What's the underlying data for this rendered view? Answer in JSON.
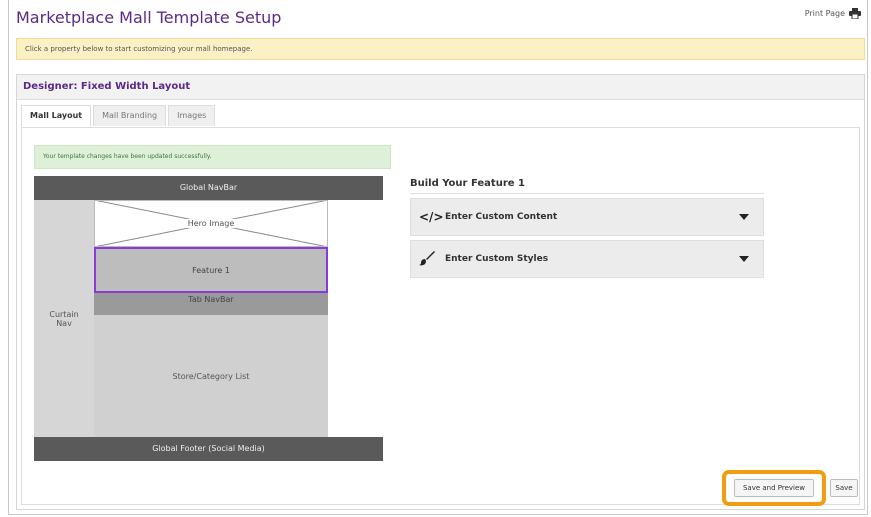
{
  "page": {
    "title": "Marketplace Mall Template Setup",
    "print_label": "Print Page",
    "notice": "Click a property below to start customizing your mall homepage."
  },
  "designer": {
    "heading": "Designer: Fixed Width Layout",
    "tabs": [
      {
        "label": "Mall Layout",
        "active": true
      },
      {
        "label": "Mall Branding",
        "active": false
      },
      {
        "label": "Images",
        "active": false
      }
    ],
    "success": "Your template changes have been updated successfully."
  },
  "layout": {
    "global_navbar": "Global NavBar",
    "hero_image": "Hero Image",
    "feature": "Feature 1",
    "curtain_nav": "Curtain\nNav",
    "tab_navbar": "Tab NavBar",
    "store_list": "Store/Category List",
    "global_footer": "Global Footer (Social Media)"
  },
  "builder": {
    "title": "Build Your Feature 1",
    "sections": [
      {
        "icon": "code-icon",
        "glyph": "</>",
        "label": "Enter Custom Content"
      },
      {
        "icon": "paintbrush-icon",
        "glyph": "",
        "label": "Enter Custom Styles"
      }
    ]
  },
  "actions": {
    "save_preview": "Save and Preview",
    "save": "Save"
  },
  "colors": {
    "accent": "#5b2a86",
    "feature_outline": "#8a3bd6",
    "highlight": "#f39c12"
  }
}
